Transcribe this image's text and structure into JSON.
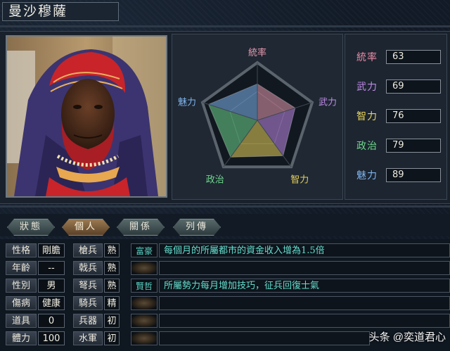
{
  "character": {
    "name": "曼沙穆薩"
  },
  "radar": {
    "labels": [
      "統率",
      "武力",
      "智力",
      "政治",
      "魅力"
    ],
    "label_colors": [
      "#e89ab0",
      "#c08be8",
      "#e8d25a",
      "#6fd58c",
      "#7fb4ee"
    ],
    "max": 100
  },
  "stats": [
    {
      "label": "統率",
      "value": "63",
      "color": "#ec8aa6"
    },
    {
      "label": "武力",
      "value": "69",
      "color": "#c18ae8"
    },
    {
      "label": "智力",
      "value": "76",
      "color": "#e8d45a"
    },
    {
      "label": "政治",
      "value": "79",
      "color": "#6fd58c"
    },
    {
      "label": "魅力",
      "value": "89",
      "color": "#7fb4ee"
    }
  ],
  "tabs": [
    {
      "label": "狀態",
      "active": false
    },
    {
      "label": "個人",
      "active": true
    },
    {
      "label": "關係",
      "active": false
    },
    {
      "label": "列傳",
      "active": false
    }
  ],
  "personal": [
    {
      "label": "性格",
      "value": "剛膽"
    },
    {
      "label": "年齡",
      "value": "--"
    },
    {
      "label": "性別",
      "value": "男"
    },
    {
      "label": "傷病",
      "value": "健康"
    },
    {
      "label": "道具",
      "value": "0"
    },
    {
      "label": "體力",
      "value": "100"
    }
  ],
  "aptitudes": [
    {
      "label": "槍兵",
      "value": "熟"
    },
    {
      "label": "戟兵",
      "value": "熟"
    },
    {
      "label": "弩兵",
      "value": "熟"
    },
    {
      "label": "騎兵",
      "value": "精"
    },
    {
      "label": "兵器",
      "value": "初"
    },
    {
      "label": "水軍",
      "value": "初"
    }
  ],
  "skills": [
    {
      "tag": "富豪",
      "desc": "每個月的所屬都市的資金收入增為1.5倍"
    },
    {
      "tag": "",
      "desc": ""
    },
    {
      "tag": "賢哲",
      "desc": "所屬勢力每月增加技巧，征兵回復士氣"
    },
    {
      "tag": "",
      "desc": ""
    },
    {
      "tag": "",
      "desc": ""
    },
    {
      "tag": "",
      "desc": ""
    }
  ],
  "watermark": "头条 @奕道君心",
  "colors": {
    "accent_skill": "#5ad2c4",
    "active_tab": "#8a6a44"
  }
}
